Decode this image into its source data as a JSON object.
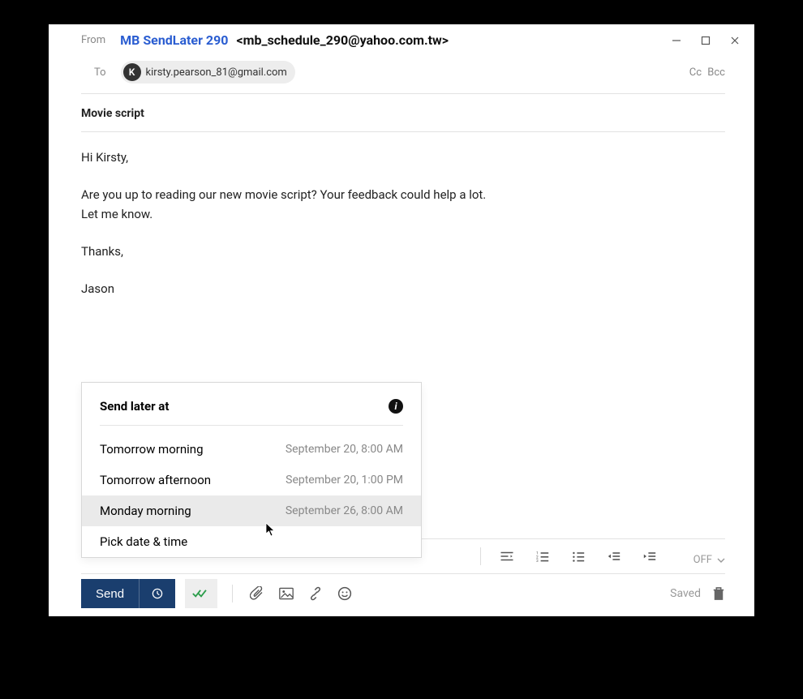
{
  "header": {
    "from_label": "From",
    "sender_name": "MB SendLater 290",
    "sender_email": "<mb_schedule_290@yahoo.com.tw>",
    "to_label": "To",
    "recipient_initial": "K",
    "recipient_email": "kirsty.pearson_81@gmail.com",
    "cc_label": "Cc",
    "bcc_label": "Bcc"
  },
  "subject": "Movie script",
  "body": {
    "greeting": "Hi Kirsty,",
    "line1": "Are you up to reading our new movie script? Your feedback could help a lot.",
    "line2": "Let me know.",
    "thanks": "Thanks,",
    "signature": "Jason"
  },
  "popup": {
    "title": "Send later at",
    "items": [
      {
        "label": "Tomorrow morning",
        "when": "September 20, 8:00 AM"
      },
      {
        "label": "Tomorrow afternoon",
        "when": "September 20, 1:00 PM"
      },
      {
        "label": "Monday morning",
        "when": "September 26, 8:00 AM"
      },
      {
        "label": "Pick date & time",
        "when": ""
      }
    ]
  },
  "toolbar": {
    "send_label": "Send",
    "off_label": "OFF",
    "saved_label": "Saved"
  }
}
